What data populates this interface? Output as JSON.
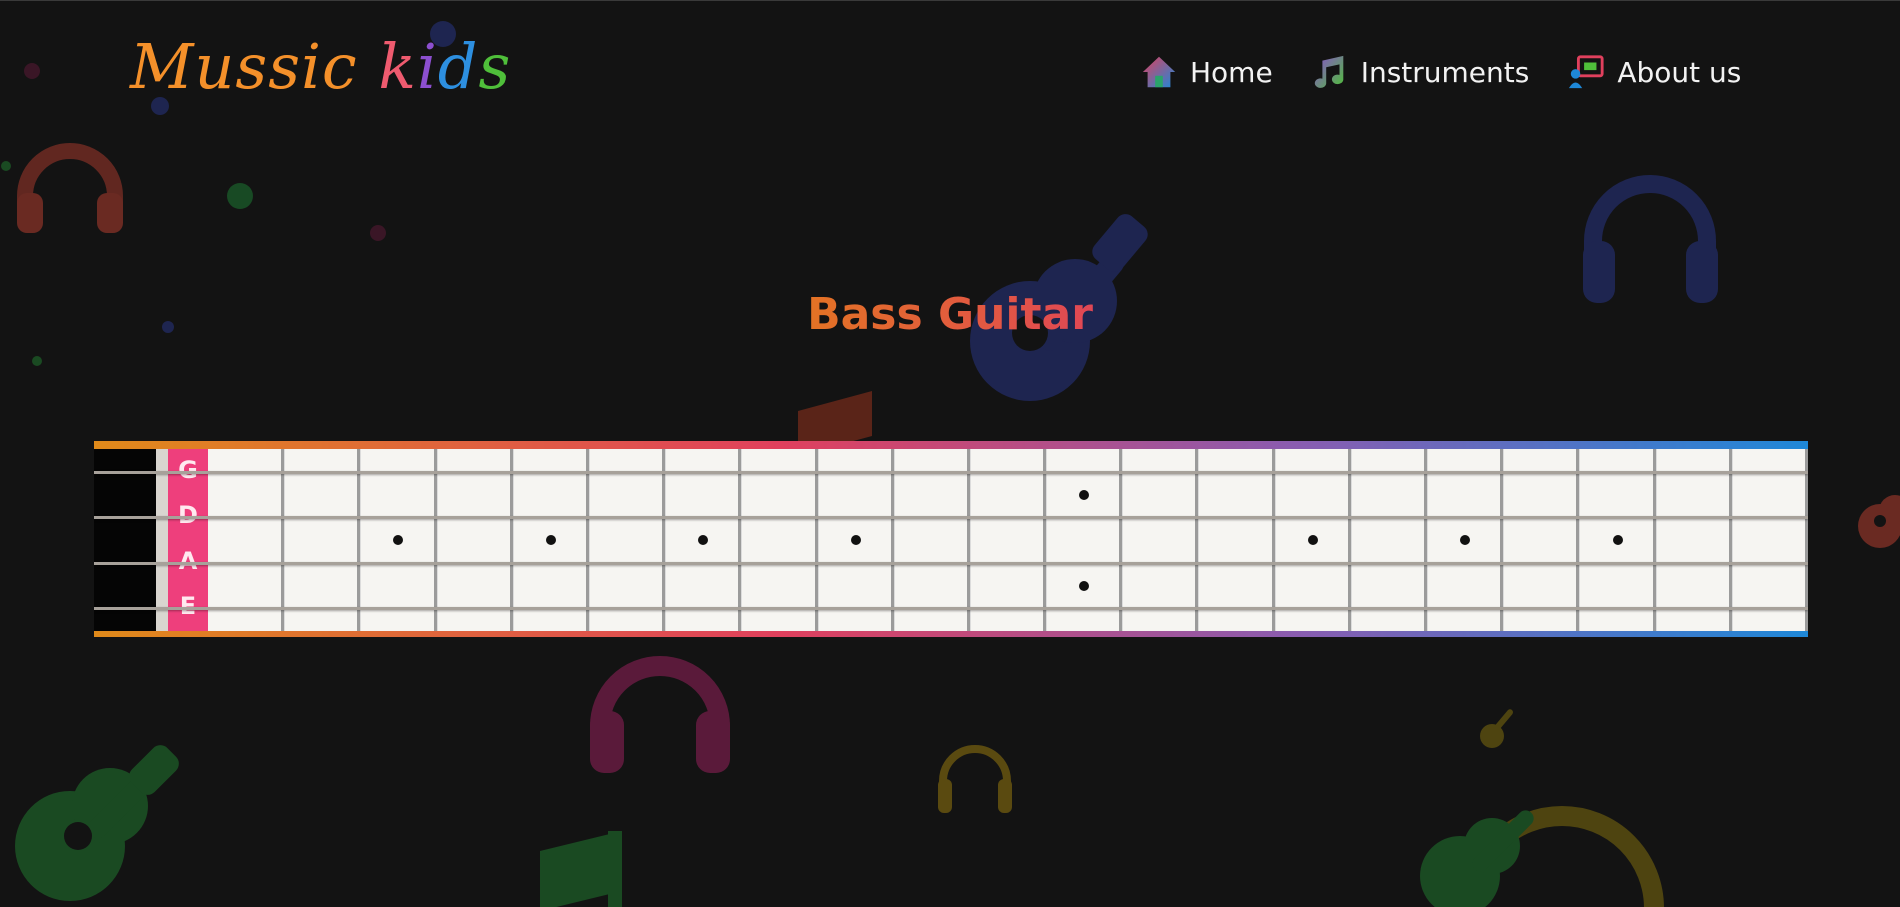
{
  "header": {
    "logo_letters": [
      {
        "ch": "M",
        "color": "#f4902a"
      },
      {
        "ch": "u",
        "color": "#f4902a"
      },
      {
        "ch": "s",
        "color": "#f4902a"
      },
      {
        "ch": "s",
        "color": "#f4902a"
      },
      {
        "ch": "i",
        "color": "#f4902a"
      },
      {
        "ch": "c",
        "color": "#f4902a"
      },
      {
        "ch": " ",
        "color": "#f4902a"
      },
      {
        "ch": "k",
        "color": "#ef5b6f"
      },
      {
        "ch": "i",
        "color": "#8c4fcf"
      },
      {
        "ch": "d",
        "color": "#2d8fe0"
      },
      {
        "ch": "s",
        "color": "#4fbf3a"
      }
    ],
    "logo_text": "Mussic kids",
    "nav": [
      {
        "label": "Home",
        "icon": "home-icon"
      },
      {
        "label": "Instruments",
        "icon": "music-note-icon"
      },
      {
        "label": "About us",
        "icon": "presentation-icon"
      }
    ]
  },
  "main": {
    "title": "Bass Guitar",
    "fretboard": {
      "strings": [
        "G",
        "D",
        "A",
        "E"
      ],
      "fret_count": 21,
      "markers": [
        {
          "gap": "G-D",
          "fret": 12
        },
        {
          "gap": "D-A",
          "fret": 3
        },
        {
          "gap": "D-A",
          "fret": 5
        },
        {
          "gap": "D-A",
          "fret": 7
        },
        {
          "gap": "D-A",
          "fret": 9
        },
        {
          "gap": "D-A",
          "fret": 15
        },
        {
          "gap": "D-A",
          "fret": 17
        },
        {
          "gap": "D-A",
          "fret": 19
        },
        {
          "gap": "A-E",
          "fret": 12
        }
      ]
    }
  },
  "colors": {
    "background": "#131313",
    "accent_orange": "#e47a1c",
    "accent_pink": "#ee3f7c",
    "accent_blue": "#1e88d8"
  }
}
